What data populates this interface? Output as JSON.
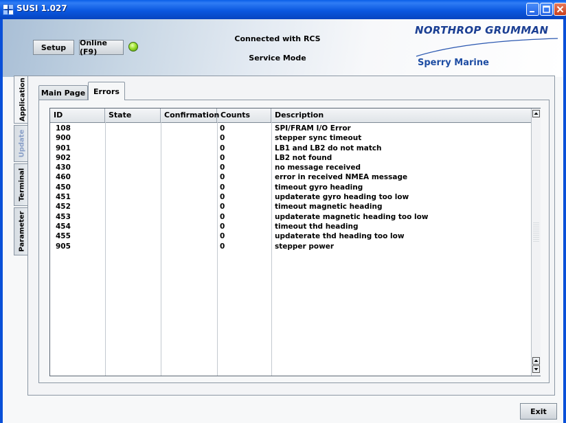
{
  "window": {
    "title": "SUSI 1.027",
    "titlebar_color": "#0a5fe8"
  },
  "header": {
    "setup_label": "Setup",
    "online_label": "Online (F9)",
    "status_led_color": "#9be02c",
    "connection_text": "Connected with RCS",
    "mode_text": "Service Mode",
    "brand_logo": "NORTHROP GRUMMAN",
    "brand_sub": "Sperry Marine"
  },
  "side_tabs": [
    {
      "label": "Application",
      "active": true
    },
    {
      "label": "Update",
      "disabled": true
    },
    {
      "label": "Terminal"
    },
    {
      "label": "Parameter"
    }
  ],
  "main_tabs": [
    {
      "label": "Main Page"
    },
    {
      "label": "Errors",
      "active": true
    }
  ],
  "error_table": {
    "columns": [
      "ID",
      "State",
      "Confirmation",
      "Counts",
      "Description"
    ],
    "rows": [
      {
        "id": "108",
        "state": "",
        "confirmation": "",
        "counts": "0",
        "description": "SPI/FRAM I/O Error"
      },
      {
        "id": "900",
        "state": "",
        "confirmation": "",
        "counts": "0",
        "description": "stepper sync timeout"
      },
      {
        "id": "901",
        "state": "",
        "confirmation": "",
        "counts": "0",
        "description": "LB1 and LB2 do not match"
      },
      {
        "id": "902",
        "state": "",
        "confirmation": "",
        "counts": "0",
        "description": "LB2 not found"
      },
      {
        "id": "430",
        "state": "",
        "confirmation": "",
        "counts": "0",
        "description": "no message received"
      },
      {
        "id": "460",
        "state": "",
        "confirmation": "",
        "counts": "0",
        "description": "error in received NMEA message"
      },
      {
        "id": "450",
        "state": "",
        "confirmation": "",
        "counts": "0",
        "description": "timeout gyro heading"
      },
      {
        "id": "451",
        "state": "",
        "confirmation": "",
        "counts": "0",
        "description": "updaterate gyro heading too low"
      },
      {
        "id": "452",
        "state": "",
        "confirmation": "",
        "counts": "0",
        "description": "timeout magnetic heading"
      },
      {
        "id": "453",
        "state": "",
        "confirmation": "",
        "counts": "0",
        "description": "updaterate magnetic heading too low"
      },
      {
        "id": "454",
        "state": "",
        "confirmation": "",
        "counts": "0",
        "description": "timeout thd heading"
      },
      {
        "id": "455",
        "state": "",
        "confirmation": "",
        "counts": "0",
        "description": "updaterate thd heading too low"
      },
      {
        "id": "905",
        "state": "",
        "confirmation": "",
        "counts": "0",
        "description": "stepper power"
      }
    ]
  },
  "footer": {
    "exit_label": "Exit"
  }
}
